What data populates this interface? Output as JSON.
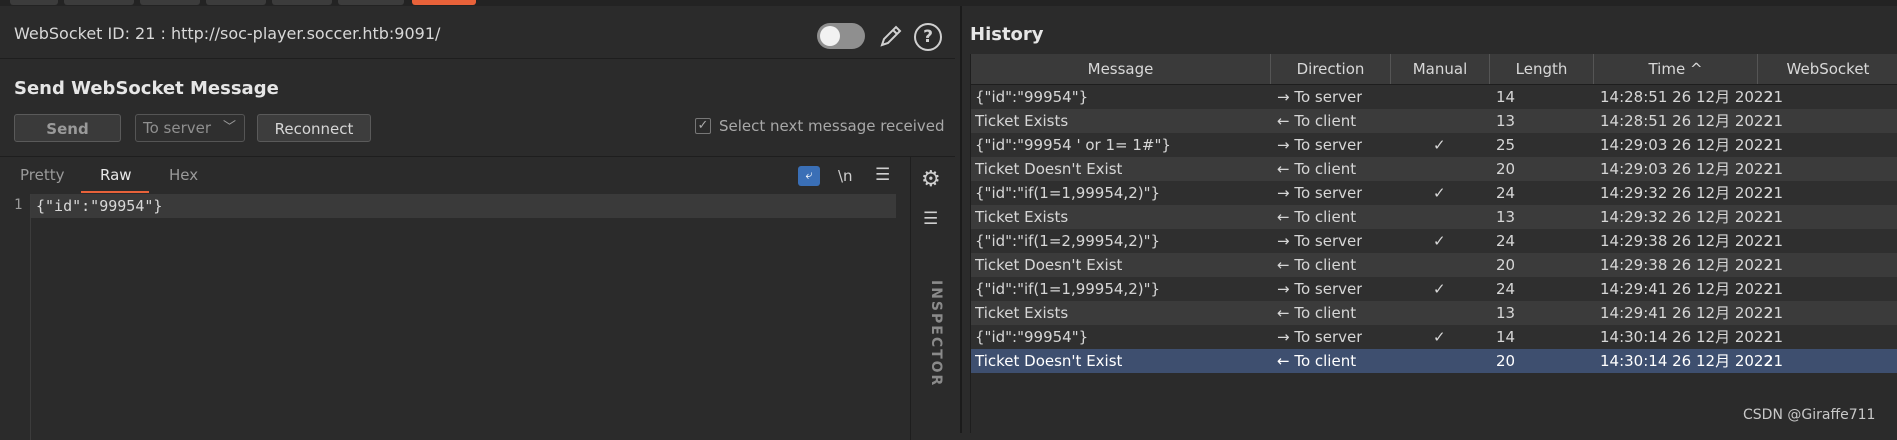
{
  "websocket": {
    "id_line": "WebSocket ID: 21 : http://soc-player.soccer.htb:9091/"
  },
  "send": {
    "title": "Send WebSocket Message",
    "send_label": "Send",
    "direction_value": "To server",
    "reconnect_label": "Reconnect",
    "select_next_label": "Select next message received",
    "select_next_checked": true
  },
  "editor": {
    "tabs": [
      "Pretty",
      "Raw",
      "Hex"
    ],
    "active_tab": "Raw",
    "newline_toggle": "\\n",
    "line_number": "1",
    "content": "{\"id\":\"99954\"}"
  },
  "inspector": {
    "label": "INSPECTOR"
  },
  "history": {
    "title": "History",
    "columns": [
      "Message",
      "Direction",
      "Manual",
      "Length",
      "Time ^",
      "WebSocket"
    ],
    "rows": [
      {
        "message": "{\"id\":\"99954\"}",
        "direction": "→ To server",
        "manual": "",
        "length": "14",
        "time": "14:28:51 26 12月 2022",
        "ws": "21"
      },
      {
        "message": "Ticket Exists",
        "direction": "← To client",
        "manual": "",
        "length": "13",
        "time": "14:28:51 26 12月 2022",
        "ws": "21"
      },
      {
        "message": "{\"id\":\"99954 ' or 1= 1#\"}",
        "direction": "→ To server",
        "manual": "✓",
        "length": "25",
        "time": "14:29:03 26 12月 2022",
        "ws": "21"
      },
      {
        "message": "Ticket Doesn't Exist",
        "direction": "← To client",
        "manual": "",
        "length": "20",
        "time": "14:29:03 26 12月 2022",
        "ws": "21"
      },
      {
        "message": "{\"id\":\"if(1=1,99954,2)\"}",
        "direction": "→ To server",
        "manual": "✓",
        "length": "24",
        "time": "14:29:32 26 12月 2022",
        "ws": "21"
      },
      {
        "message": "Ticket Exists",
        "direction": "← To client",
        "manual": "",
        "length": "13",
        "time": "14:29:32 26 12月 2022",
        "ws": "21"
      },
      {
        "message": "{\"id\":\"if(1=2,99954,2)\"}",
        "direction": "→ To server",
        "manual": "✓",
        "length": "24",
        "time": "14:29:38 26 12月 2022",
        "ws": "21"
      },
      {
        "message": "Ticket Doesn't Exist",
        "direction": "← To client",
        "manual": "",
        "length": "20",
        "time": "14:29:38 26 12月 2022",
        "ws": "21"
      },
      {
        "message": "{\"id\":\"if(1=1,99954,2)\"}",
        "direction": "→ To server",
        "manual": "✓",
        "length": "24",
        "time": "14:29:41 26 12月 2022",
        "ws": "21"
      },
      {
        "message": "Ticket Exists",
        "direction": "← To client",
        "manual": "",
        "length": "13",
        "time": "14:29:41 26 12月 2022",
        "ws": "21"
      },
      {
        "message": "{\"id\":\"99954\"}",
        "direction": "→ To server",
        "manual": "✓",
        "length": "14",
        "time": "14:30:14 26 12月 2022",
        "ws": "21"
      },
      {
        "message": "Ticket Doesn't Exist",
        "direction": "← To client",
        "manual": "",
        "length": "20",
        "time": "14:30:14 26 12月 2022",
        "ws": "21"
      }
    ],
    "selected_row": 11
  },
  "watermark": "CSDN @Giraffe711",
  "colors": {
    "accent": "#e8623a",
    "selection": "#3e4f6f",
    "wrap_button": "#3a6fb6"
  }
}
